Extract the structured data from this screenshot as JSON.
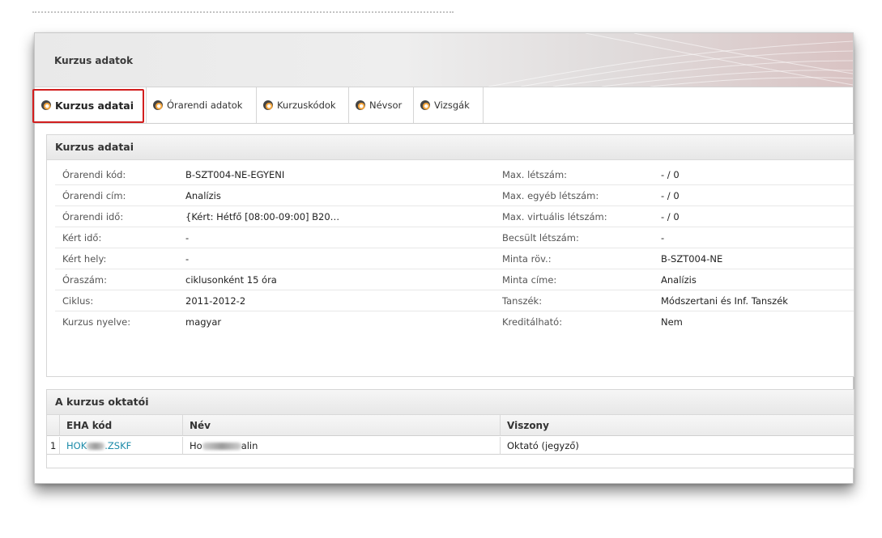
{
  "header": {
    "title": "Kurzus adatok"
  },
  "tabs": [
    {
      "label": "Kurzus adatai",
      "active": true
    },
    {
      "label": "Órarendi adatok",
      "active": false
    },
    {
      "label": "Kurzuskódok",
      "active": false
    },
    {
      "label": "Névsor",
      "active": false
    },
    {
      "label": "Vizsgák",
      "active": false
    }
  ],
  "details": {
    "title": "Kurzus adatai",
    "rows": [
      {
        "l1": "Órarendi kód:",
        "v1": "B-SZT004-NE-EGYENI",
        "l2": "Max. létszám:",
        "v2": "- / 0"
      },
      {
        "l1": "Órarendi cím:",
        "v1": "Analízis",
        "l2": "Max. egyéb létszám:",
        "v2": "- / 0"
      },
      {
        "l1": "Órarendi idő:",
        "v1": "{Kért: Hétfő [08:00-09:00] B20…",
        "l2": "Max. virtuális létszám:",
        "v2": "- / 0"
      },
      {
        "l1": "Kért idő:",
        "v1": "-",
        "l2": "Becsült létszám:",
        "v2": "-"
      },
      {
        "l1": "Kért hely:",
        "v1": "-",
        "l2": "Minta röv.:",
        "v2": "B-SZT004-NE"
      },
      {
        "l1": "Óraszám:",
        "v1": "ciklusonként 15 óra",
        "l2": "Minta címe:",
        "v2": "Analízis"
      },
      {
        "l1": "Ciklus:",
        "v1": "2011-2012-2",
        "l2": "Tanszék:",
        "v2": "Módszertani és Inf. Tanszék"
      },
      {
        "l1": "Kurzus nyelve:",
        "v1": "magyar",
        "l2": "Kreditálható:",
        "v2": "Nem"
      }
    ]
  },
  "instructors": {
    "title": "A kurzus oktatói",
    "columns": [
      "EHA kód",
      "Név",
      "Viszony"
    ],
    "rows": [
      {
        "num": "1",
        "code_a": "HOK",
        "code_b": ".ZSKF",
        "name_a": "Ho",
        "name_b": "alin",
        "relation": "Oktató (jegyző)"
      }
    ]
  },
  "colors": {
    "highlight": "#d21e1e",
    "link": "#1a8aa8"
  },
  "icons": {
    "tab": "orange-swirl-icon"
  }
}
